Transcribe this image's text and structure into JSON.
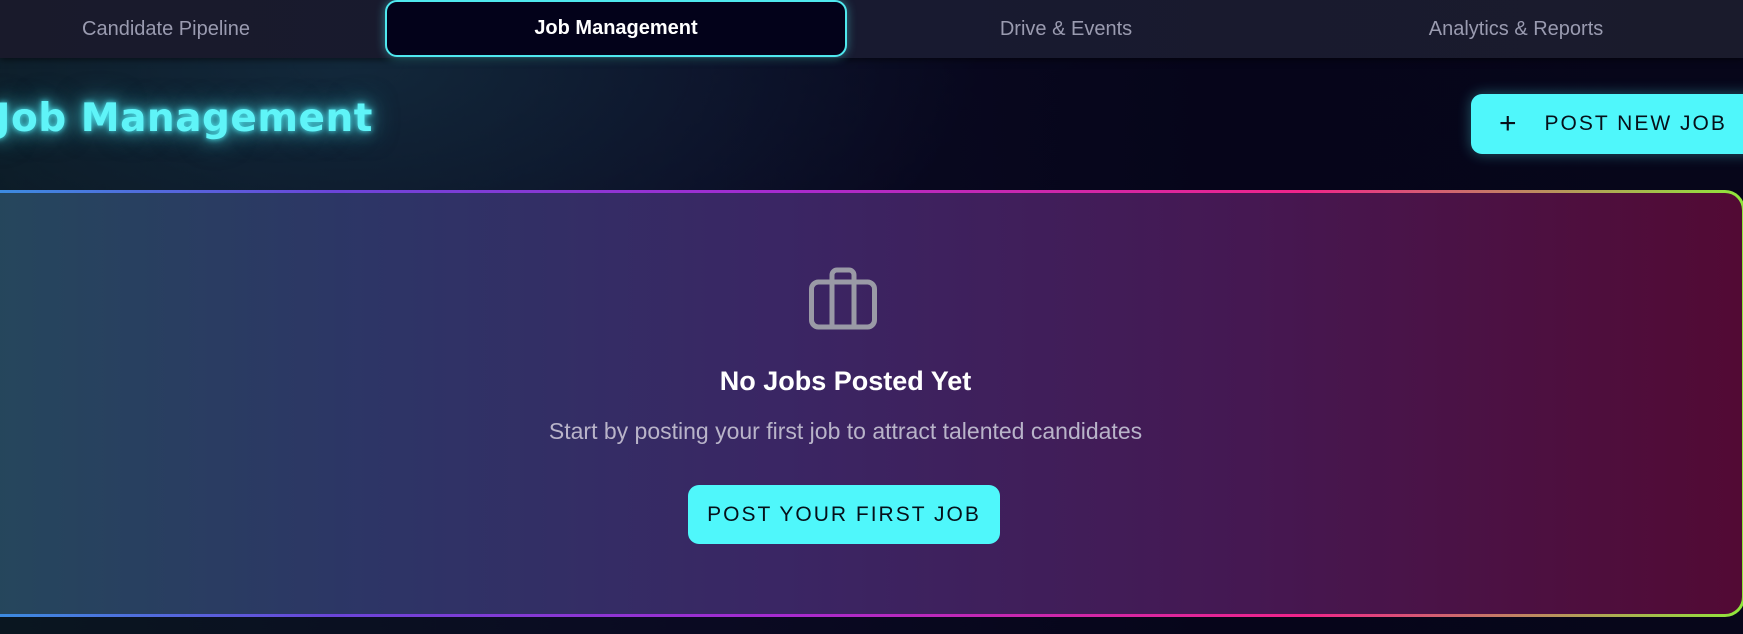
{
  "tabs": [
    {
      "label": "Candidate Pipeline",
      "active": false
    },
    {
      "label": "Job Management",
      "active": true
    },
    {
      "label": "Drive & Events",
      "active": false
    },
    {
      "label": "Analytics & Reports",
      "active": false
    }
  ],
  "header": {
    "title": "Job Management",
    "post_button_label": "POST NEW JOB",
    "post_button_icon": "plus-icon"
  },
  "empty_state": {
    "icon": "briefcase-icon",
    "title": "No Jobs Posted Yet",
    "subtitle": "Start by posting your first job to attract talented candidates",
    "button_label": "POST YOUR FIRST JOB"
  },
  "colors": {
    "accent": "#4ff7fb",
    "active_tab_border": "#4fe8ee",
    "title_glow": "#5ff4f8"
  }
}
